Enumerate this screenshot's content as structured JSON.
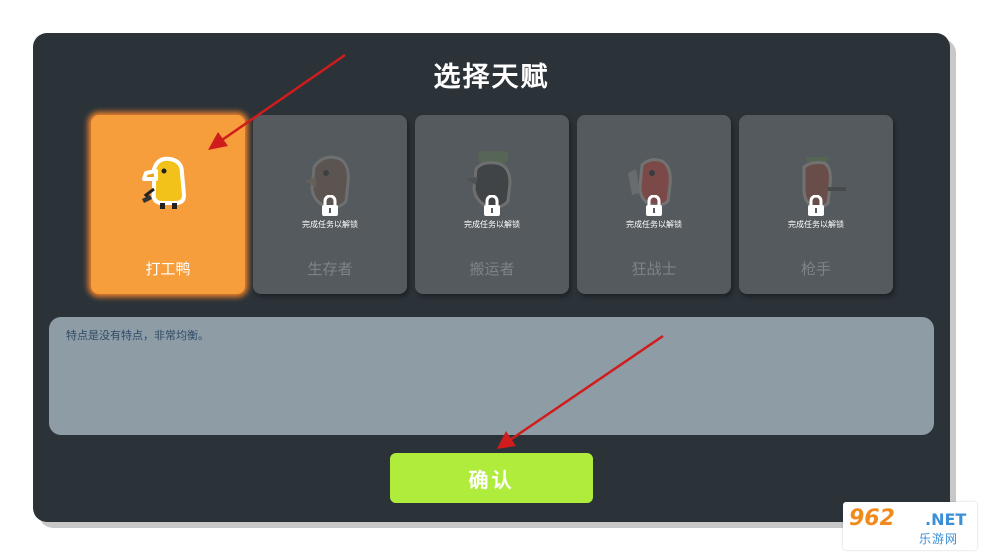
{
  "screen": {
    "title": "选择天赋",
    "talents": [
      {
        "name": "打工鸭",
        "locked": false,
        "selected": true,
        "icon": "duck-icon"
      },
      {
        "name": "生存者",
        "locked": true,
        "selected": false,
        "lock_text": "完成任务以解锁",
        "icon": "survivor-icon"
      },
      {
        "name": "搬运者",
        "locked": true,
        "selected": false,
        "lock_text": "完成任务以解锁",
        "icon": "porter-icon"
      },
      {
        "name": "狂战士",
        "locked": true,
        "selected": false,
        "lock_text": "完成任务以解锁",
        "icon": "berserker-icon"
      },
      {
        "name": "枪手",
        "locked": true,
        "selected": false,
        "lock_text": "完成任务以解锁",
        "icon": "gunner-icon"
      }
    ],
    "description": "特点是没有特点，非常均衡。",
    "confirm_label": "确认"
  },
  "watermark": {
    "logo": "962",
    "net": ".NET",
    "sub": "乐游网"
  },
  "colors": {
    "panel": "#2b3339",
    "selected_card": "#f79e3c",
    "locked_card": "#545a5e",
    "description_box": "#8e9ca6",
    "confirm_button": "#b0ec3c",
    "annotation_arrow": "#d11c1c"
  }
}
